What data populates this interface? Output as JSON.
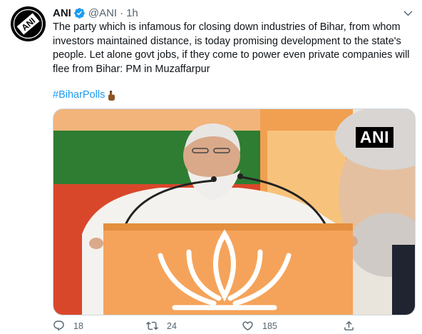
{
  "tweet": {
    "author_name": "ANI",
    "handle": "@ANI",
    "separator": "·",
    "time": "1h",
    "avatar_text": "ANI",
    "text": "The party which is infamous for closing down industries of Bihar, from whom investors maintained distance, is today promising development to the state's people. Let alone govt jobs, if they come to power even private companies will flee from Bihar: PM in Muzaffarpur",
    "hashtag": "#BiharPolls",
    "media_watermark": "ANI"
  },
  "actions": {
    "replies": "18",
    "retweets": "24",
    "likes": "185"
  },
  "icons": [
    "verified-icon",
    "more-icon",
    "finger-emoji-icon",
    "reply-icon",
    "retweet-icon",
    "like-icon",
    "share-icon"
  ],
  "colors": {
    "link": "#1d9bf0",
    "secondary_text": "#536471",
    "verified": "#1d9bf0"
  }
}
